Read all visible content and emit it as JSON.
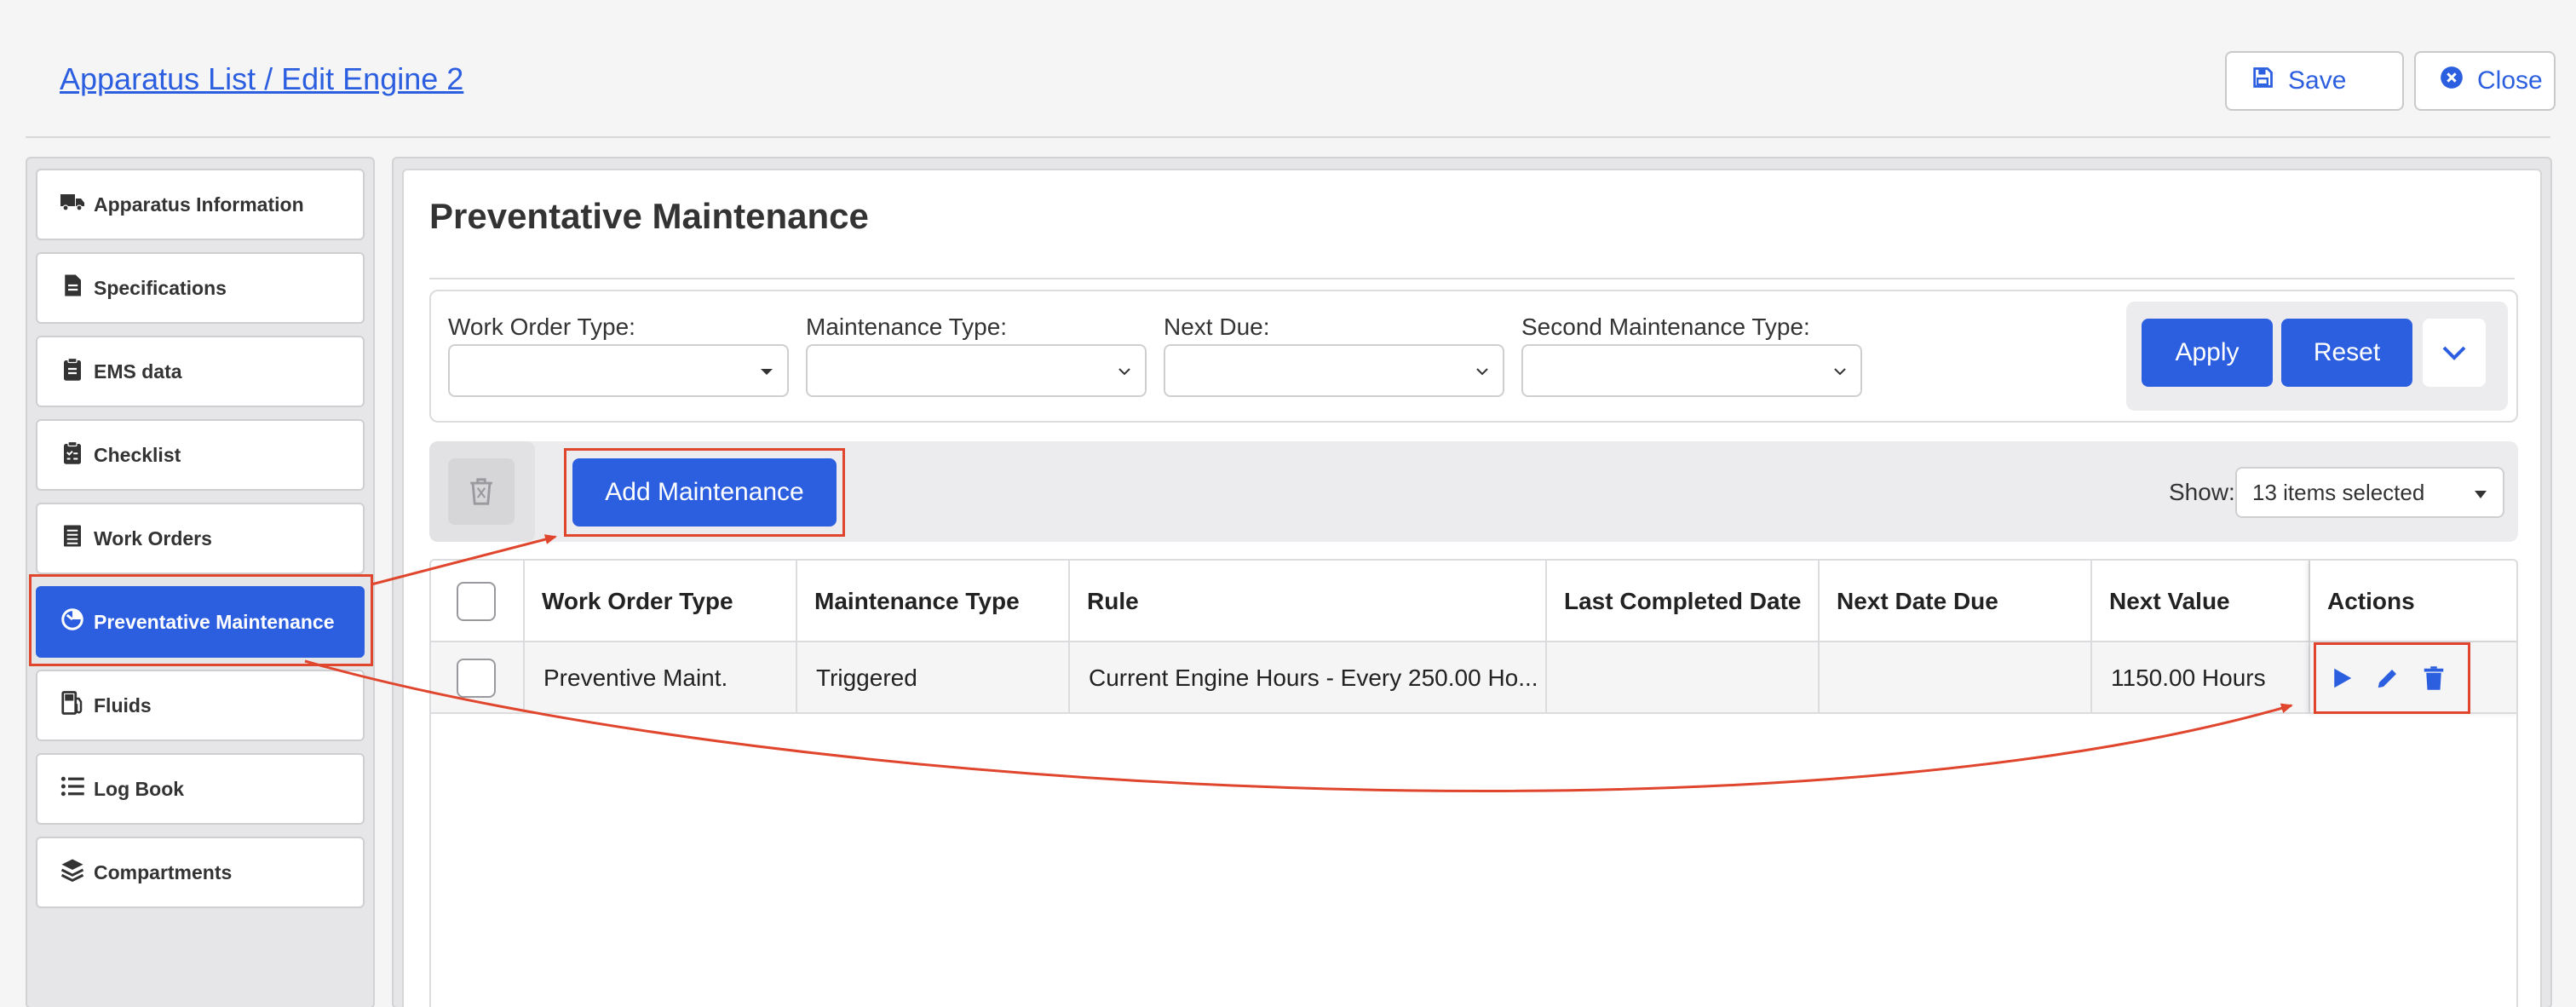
{
  "header": {
    "breadcrumb": "Apparatus List / Edit Engine 2",
    "save_label": "Save",
    "close_label": "Close"
  },
  "sidebar": {
    "items": [
      {
        "label": "Apparatus Information",
        "icon": "truck-icon"
      },
      {
        "label": "Specifications",
        "icon": "document-icon"
      },
      {
        "label": "EMS data",
        "icon": "clipboard-icon"
      },
      {
        "label": "Checklist",
        "icon": "clipboard-check-icon"
      },
      {
        "label": "Work Orders",
        "icon": "list-doc-icon"
      },
      {
        "label": "Preventative Maintenance",
        "icon": "gauge-icon",
        "active": true
      },
      {
        "label": "Fluids",
        "icon": "fuel-icon"
      },
      {
        "label": "Log Book",
        "icon": "list-icon"
      },
      {
        "label": "Compartments",
        "icon": "layers-icon"
      }
    ]
  },
  "main": {
    "title": "Preventative Maintenance",
    "filters": {
      "work_order_type": {
        "label": "Work Order Type:",
        "value": ""
      },
      "maintenance_type": {
        "label": "Maintenance Type:",
        "value": ""
      },
      "next_due": {
        "label": "Next Due:",
        "value": ""
      },
      "second_maintenance_type": {
        "label": "Second Maintenance Type:",
        "value": ""
      },
      "apply_label": "Apply",
      "reset_label": "Reset"
    },
    "toolbar": {
      "add_label": "Add Maintenance",
      "show_label": "Show:",
      "show_value": "13 items selected"
    },
    "table": {
      "columns": [
        "Work Order Type",
        "Maintenance Type",
        "Rule",
        "Last Completed Date",
        "Next Date Due",
        "Next Value",
        "Actions"
      ],
      "rows": [
        {
          "work_order_type": "Preventive Maint.",
          "maintenance_type": "Triggered",
          "rule": "Current Engine Hours - Every 250.00 Ho...",
          "last_completed": "",
          "next_date_due": "",
          "next_value": "1150.00 Hours"
        }
      ]
    }
  },
  "colors": {
    "accent": "#2c5fe0",
    "highlight": "#e0462d",
    "background": "#f5f5f6"
  }
}
